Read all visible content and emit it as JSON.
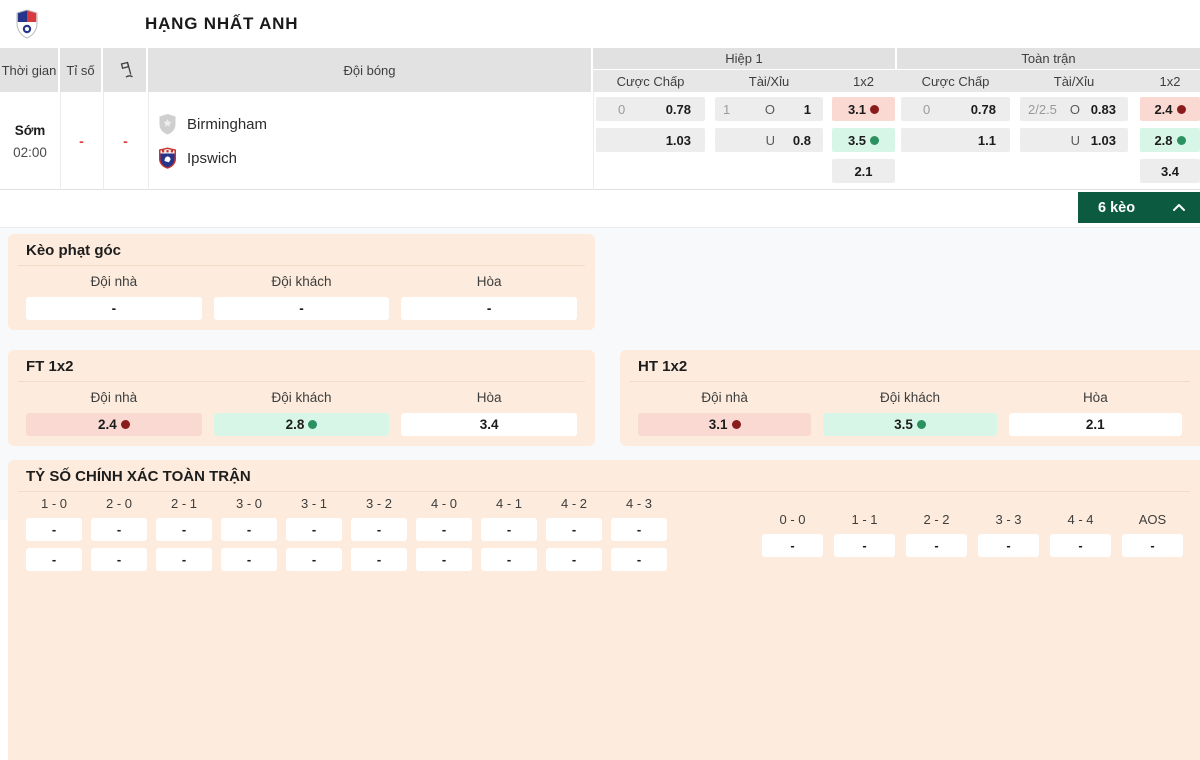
{
  "header": {
    "league": "HẠNG NHẤT ANH"
  },
  "table": {
    "columns": {
      "time": "Thời gian",
      "score": "Tỉ số",
      "teams": "Đội bóng"
    },
    "groups": {
      "h1": "Hiệp 1",
      "full": "Toàn trận"
    },
    "sub": {
      "handicap": "Cược Chấp",
      "total": "Tài/Xỉu",
      "x12": "1x2"
    },
    "match": {
      "time_label": "Sớm",
      "time": "02:00",
      "score": "-",
      "corner": "-",
      "home": "Birmingham",
      "away": "Ipswich",
      "h1": {
        "handicap": {
          "line": "0",
          "home_odds": "0.78",
          "away_odds": "1.03"
        },
        "total": {
          "line": "1",
          "over_label": "O",
          "over_odds": "1",
          "under_label": "U",
          "under_odds": "0.8"
        },
        "x12": {
          "home": "3.1",
          "away": "3.5",
          "draw": "2.1"
        }
      },
      "full": {
        "handicap": {
          "line": "0",
          "home_odds": "0.78",
          "away_odds": "1.1"
        },
        "total": {
          "line": "2/2.5",
          "over_label": "O",
          "over_odds": "0.83",
          "under_label": "U",
          "under_odds": "1.03"
        },
        "x12": {
          "home": "2.4",
          "away": "2.8",
          "draw": "3.4"
        }
      }
    }
  },
  "keo": {
    "label": "6 kèo"
  },
  "sections": {
    "corner": {
      "title": "Kèo phạt góc",
      "cols": [
        {
          "label": "Đội nhà",
          "value": "-",
          "bg": "white"
        },
        {
          "label": "Đội khách",
          "value": "-",
          "bg": "white"
        },
        {
          "label": "Hòa",
          "value": "-",
          "bg": "white"
        }
      ]
    },
    "ft1x2": {
      "title": "FT 1x2",
      "cols": [
        {
          "label": "Đội nhà",
          "value": "2.4",
          "bg": "pink",
          "dot": "red"
        },
        {
          "label": "Đội khách",
          "value": "2.8",
          "bg": "grn",
          "dot": "green"
        },
        {
          "label": "Hòa",
          "value": "3.4",
          "bg": "white"
        }
      ]
    },
    "ht1x2": {
      "title": "HT 1x2",
      "cols": [
        {
          "label": "Đội nhà",
          "value": "3.1",
          "bg": "pink",
          "dot": "red"
        },
        {
          "label": "Đội khách",
          "value": "3.5",
          "bg": "grn",
          "dot": "green"
        },
        {
          "label": "Hòa",
          "value": "2.1",
          "bg": "white"
        }
      ]
    },
    "correct_score": {
      "title": "TỶ SỐ CHÍNH XÁC TOÀN TRẬN",
      "main_scores": [
        "1 - 0",
        "2 - 0",
        "2 - 1",
        "3 - 0",
        "3 - 1",
        "3 - 2",
        "4 - 0",
        "4 - 1",
        "4 - 2",
        "4 - 3"
      ],
      "draw_scores": [
        "0 - 0",
        "1 - 1",
        "2 - 2",
        "3 - 3",
        "4 - 4",
        "AOS"
      ],
      "placeholder": "-"
    }
  },
  "colors": {
    "accent_green_button": "#0c5a40",
    "panel_peach": "#fdecdd",
    "odds_cell_gray": "#ededed",
    "home_pink": "#fbd9d3",
    "away_green": "#d8f6e8",
    "dot_red": "#8b1c1e",
    "dot_green": "#2b9160",
    "dash_red": "#e23b3b",
    "header_gray": "#e2e2e2"
  }
}
